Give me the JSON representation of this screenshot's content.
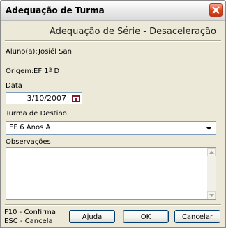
{
  "window": {
    "title": "Adequação de Turma"
  },
  "header": {
    "subtitle": "Adequação de Série - Desaceleração"
  },
  "aluno": {
    "label": "Aluno(a):",
    "value": "Josiél San"
  },
  "origem": {
    "label": "Origem:",
    "value": "EF 1ª D"
  },
  "data": {
    "label": "Data",
    "value": "3/10/2007"
  },
  "turma_destino": {
    "label": "Turma de Destino",
    "value": "EF 6 Anos A"
  },
  "observacoes": {
    "label": "Observações",
    "value": ""
  },
  "shortcuts": {
    "confirm": "F10 - Confirma",
    "cancel": "ESC - Cancela"
  },
  "buttons": {
    "help": "Ajuda",
    "ok": "OK",
    "cancel": "Cancelar"
  },
  "icons": {
    "close": "close-icon",
    "calendar": "calendar-icon",
    "dropdown": "chevron-down-icon",
    "scroll_up": "scroll-up-icon",
    "scroll_down": "scroll-down-icon"
  },
  "colors": {
    "close_button": "#d9461d",
    "input_border": "#7f9db9",
    "dialog_bg": "#ece9d8"
  }
}
